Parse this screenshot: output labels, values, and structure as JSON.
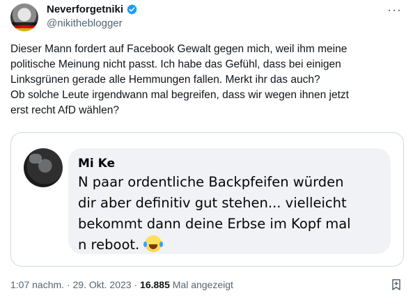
{
  "author": {
    "display_name": "Neverforgetniki",
    "handle": "@nikitheblogger",
    "verified": true
  },
  "menu": {
    "more_label": "···"
  },
  "tweet": {
    "lines": [
      "Dieser Mann fordert auf Facebook Gewalt gegen mich, weil ihm meine",
      "politische Meinung nicht passt. Ich habe das Gefühl, dass bei einigen",
      "Linksgrünen gerade alle Hemmungen fallen. Merkt ihr das auch?",
      "Ob solche Leute irgendwann mal begreifen, dass wir wegen ihnen jetzt",
      "erst recht AfD wählen?"
    ]
  },
  "embedded_comment": {
    "name": "Mi Ke",
    "lines": [
      "N paar ordentliche Backpfeifen würden",
      "dir aber definitiv gut stehen... vielleicht",
      "bekommt dann  deine Erbse im Kopf mal",
      "n reboot."
    ],
    "emoji": "laughing-crying-face"
  },
  "meta": {
    "time": "1:07 nachm.",
    "separator": "·",
    "date": "29. Okt. 2023",
    "views_count": "16.885",
    "views_label": "Mal angezeigt"
  },
  "colors": {
    "verified": "#1d9bf0",
    "secondary_text": "#536471",
    "bubble": "#f0f2f5",
    "border": "#cfd9de"
  }
}
